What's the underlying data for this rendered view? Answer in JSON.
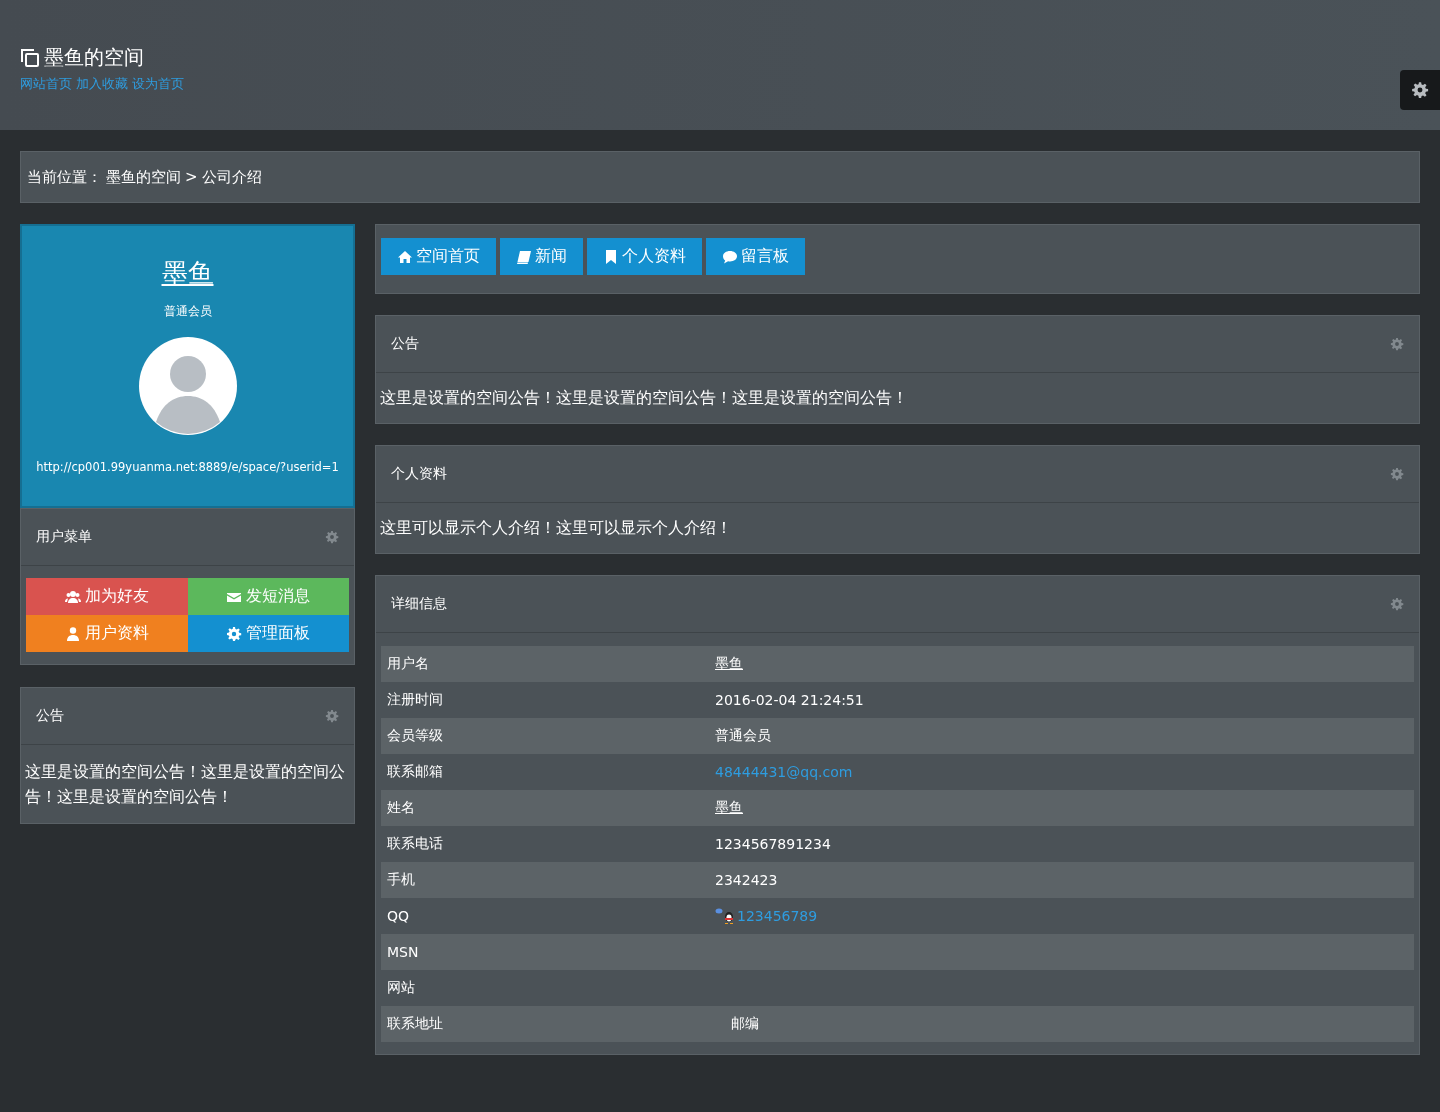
{
  "header": {
    "title": "墨鱼的空间",
    "links": [
      "网站首页",
      "加入收藏",
      "设为首页"
    ]
  },
  "breadcrumb": {
    "label": "当前位置：",
    "items": [
      "墨鱼的空间",
      "公司介绍"
    ],
    "separator": ">"
  },
  "profile": {
    "name": "墨鱼",
    "level": "普通会员",
    "url": "http://cp001.99yuanma.net:8889/e/space/?userid=1"
  },
  "user_menu": {
    "title": "用户菜单",
    "buttons": [
      {
        "label": "加为好友",
        "kind": "friends",
        "color": "#d9534f"
      },
      {
        "label": "发短消息",
        "kind": "mail",
        "color": "#5cb85c"
      },
      {
        "label": "用户资料",
        "kind": "user",
        "color": "#f0801f"
      },
      {
        "label": "管理面板",
        "kind": "gear",
        "color": "#1490d0"
      }
    ]
  },
  "side_notice": {
    "title": "公告",
    "text": "这里是设置的空间公告！这里是设置的空间公告！这里是设置的空间公告！"
  },
  "nav": [
    {
      "label": "空间首页",
      "kind": "home"
    },
    {
      "label": "新闻",
      "kind": "book"
    },
    {
      "label": "个人资料",
      "kind": "bookmark"
    },
    {
      "label": "留言板",
      "kind": "comment"
    }
  ],
  "panels": [
    {
      "title": "公告",
      "text": "这里是设置的空间公告！这里是设置的空间公告！这里是设置的空间公告！"
    },
    {
      "title": "个人资料",
      "text": "这里可以显示个人介绍！这里可以显示个人介绍！"
    }
  ],
  "details": {
    "title": "详细信息",
    "rows": [
      {
        "label": "用户名",
        "value": "墨鱼",
        "kind": "underline"
      },
      {
        "label": "注册时间",
        "value": "2016-02-04 21:24:51",
        "kind": "text"
      },
      {
        "label": "会员等级",
        "value": "普通会员",
        "kind": "text"
      },
      {
        "label": "联系邮箱",
        "value": "48444431@qq.com",
        "kind": "link"
      },
      {
        "label": "姓名",
        "value": "墨鱼",
        "kind": "underline"
      },
      {
        "label": "联系电话",
        "value": "1234567891234",
        "kind": "text"
      },
      {
        "label": "手机",
        "value": "2342423",
        "kind": "text"
      },
      {
        "label": "QQ",
        "value": "123456789",
        "kind": "qq"
      },
      {
        "label": "MSN",
        "kind": "text"
      },
      {
        "label": "网站",
        "kind": "text"
      },
      {
        "label": "联系地址",
        "value": "邮编",
        "kind": "indented"
      }
    ]
  }
}
